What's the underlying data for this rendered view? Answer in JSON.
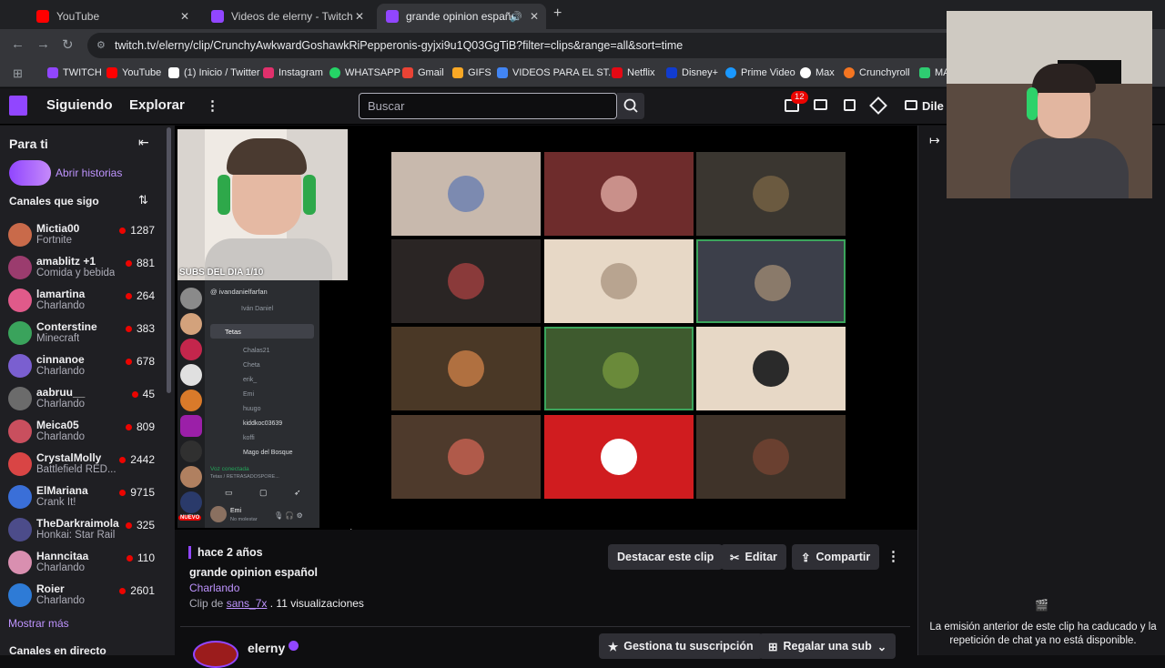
{
  "browser": {
    "tabs": [
      {
        "label": "YouTube",
        "color": "#ff0000"
      },
      {
        "label": "Videos de elerny - Twitch",
        "color": "#9146ff"
      },
      {
        "label": "grande opinion español - Tw",
        "color": "#9146ff"
      }
    ],
    "url": "twitch.tv/elerny/clip/CrunchyAwkwardGoshawkRiPepperonis-gyjxi9u1Q03GgTiB?filter=clips&range=all&sort=time",
    "bookmarks": [
      {
        "label": "TWITCH",
        "color": "#9146ff"
      },
      {
        "label": "YouTube",
        "color": "#ff0000"
      },
      {
        "label": "(1) Inicio / Twitter",
        "color": "#ffffff"
      },
      {
        "label": "Instagram",
        "color": "#e1306c"
      },
      {
        "label": "WHATSAPP",
        "color": "#25d366"
      },
      {
        "label": "Gmail",
        "color": "#ea4335"
      },
      {
        "label": "GIFS",
        "color": "#f9a825"
      },
      {
        "label": "VIDEOS PARA EL ST...",
        "color": "#4285f4"
      },
      {
        "label": "Netflix",
        "color": "#e50914"
      },
      {
        "label": "Disney+",
        "color": "#113ccf"
      },
      {
        "label": "Prime Video",
        "color": "#1a98ff"
      },
      {
        "label": "Max",
        "color": "#ffffff"
      },
      {
        "label": "Crunchyroll",
        "color": "#f47521"
      },
      {
        "label": "MA",
        "color": "#2ecc71"
      }
    ]
  },
  "topnav": {
    "following": "Siguiendo",
    "browse": "Explorar",
    "search_placeholder": "Buscar",
    "notif_count": "12",
    "cta": "Dile a"
  },
  "sidebar": {
    "for_you": "Para ti",
    "open_stories": "Abrir historias",
    "followed_title": "Canales que sigo",
    "channels": [
      {
        "name": "Mictia00",
        "game": "Fortnite",
        "viewers": "1287",
        "color": "#c96a4a"
      },
      {
        "name": "amablitz +1",
        "game": "Comida y bebida",
        "viewers": "881",
        "color": "#9b3c6e"
      },
      {
        "name": "lamartina",
        "game": "Charlando",
        "viewers": "264",
        "color": "#e05a8a"
      },
      {
        "name": "Conterstine",
        "game": "Minecraft",
        "viewers": "383",
        "color": "#3aa35c"
      },
      {
        "name": "cinnanoe",
        "game": "Charlando",
        "viewers": "678",
        "color": "#7a5fd0"
      },
      {
        "name": "aabruu__",
        "game": "Charlando",
        "viewers": "45",
        "color": "#6b6b6b"
      },
      {
        "name": "Meica05",
        "game": "Charlando",
        "viewers": "809",
        "color": "#c94f5e"
      },
      {
        "name": "CrystalMolly",
        "game": "Battlefield RED...",
        "viewers": "2442",
        "color": "#d94545"
      },
      {
        "name": "ElMariana",
        "game": "Crank It!",
        "viewers": "9715",
        "color": "#3a6fd8"
      },
      {
        "name": "TheDarkraimola",
        "game": "Honkai: Star Rail",
        "viewers": "325",
        "color": "#4c4c8a"
      },
      {
        "name": "Hanncitaa",
        "game": "Charlando",
        "viewers": "110",
        "color": "#d98fb0"
      },
      {
        "name": "Roier",
        "game": "Charlando",
        "viewers": "2601",
        "color": "#2e7bd6"
      }
    ],
    "show_more": "Mostrar más",
    "live_title": "Canales en directo"
  },
  "video": {
    "webcam_caption": "SUBS DEL DIA 1/10",
    "discord": {
      "header_user": "ivandanielfarfan",
      "header_sub": "Iván Daniel",
      "channel": "Tetas",
      "members": [
        "Chalas21",
        "Cheta",
        "erik_",
        "Emi",
        "huugo",
        "kiddkoc03639",
        "koffi",
        "Mago del Bosque"
      ],
      "voice_status": "Voz conectada",
      "voice_channel": "Tetas / RETRASADOSPORE...",
      "user": "Emi",
      "user_status": "No molestar",
      "new_badge": "NUEVO"
    },
    "grid_colors": [
      "#c8b9ad",
      "#6e2c2c",
      "#3a3630",
      "#2a2524",
      "#e7d8c6",
      "#3c3f4a",
      "#4a3826",
      "#3e5a2e",
      "#e7d8c6",
      "#4e3a2c",
      "#d01c1f",
      "#3f3329"
    ],
    "grid_avatars": [
      "#7c8ab0",
      "#c9908a",
      "#6b5a40",
      "#8a3a3a",
      "#b8a490",
      "#8a7a6a",
      "#b07040",
      "#6a8a3a",
      "#2a2a2a",
      "#b05a4a",
      "#ffffff",
      "#6a4030"
    ],
    "highlighted_border": "#3ba55c"
  },
  "clip": {
    "age": "hace 2 años",
    "title": "grande opinion español",
    "category": "Charlando",
    "clip_by_prefix": "Clip de",
    "clipper": "sans_7x",
    "views": ". 11 visualizaciones",
    "feature_btn": "Destacar este clip",
    "edit_btn": "Editar",
    "share_btn": "Compartir",
    "streamer": "elerny",
    "manage_sub": "Gestiona tu suscripción",
    "gift_sub": "Regalar una sub"
  },
  "chat": {
    "expired_msg": "La emisión anterior de este clip ha caducado y la repetición de chat ya no está disponible."
  },
  "colors": {
    "accent": "#9146ff",
    "live": "#eb0400",
    "link": "#bf94ff"
  }
}
